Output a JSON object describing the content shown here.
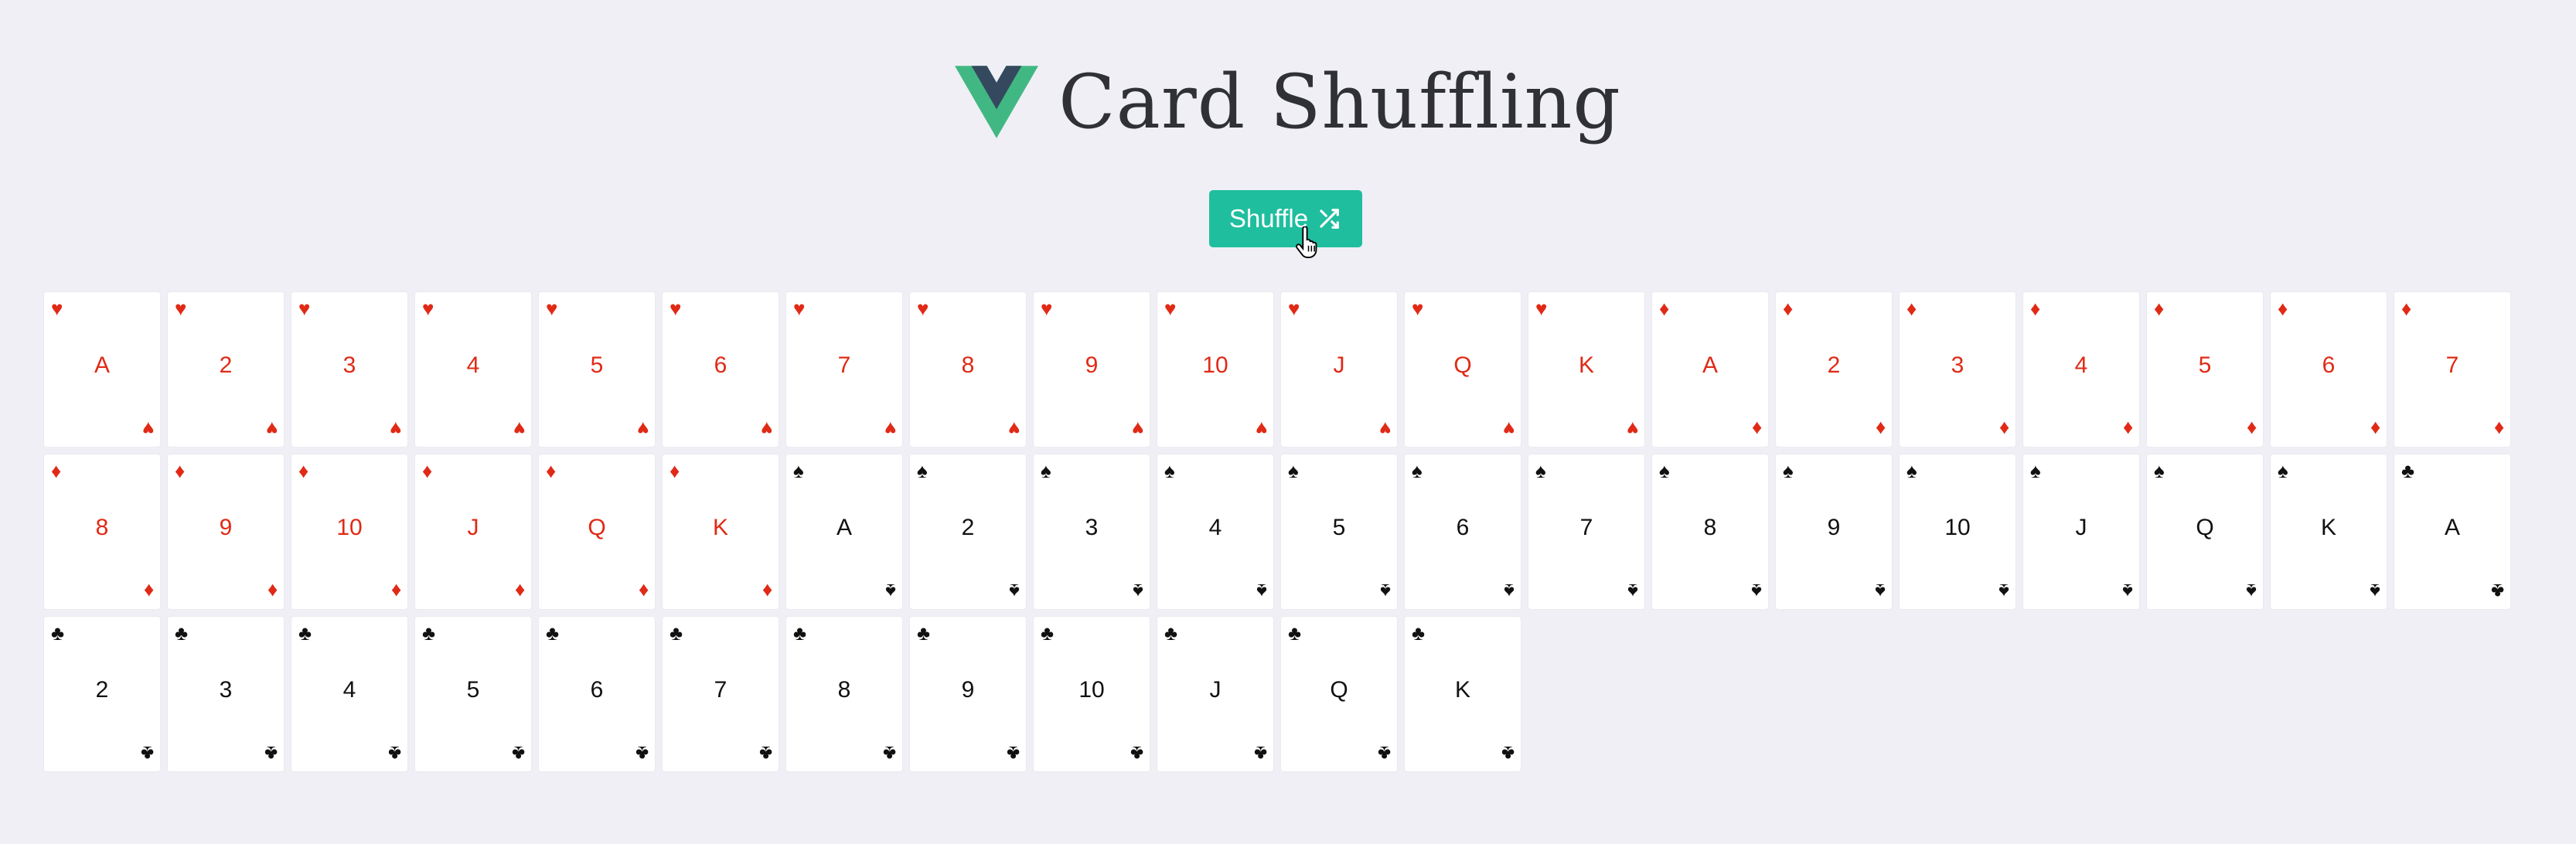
{
  "header": {
    "title": "Card Shuffling",
    "logo_icon": "vue-logo-icon",
    "logo_colors": {
      "outer": "#41b883",
      "inner": "#35495e"
    }
  },
  "toolbar": {
    "shuffle_label": "Shuffle",
    "shuffle_icon": "shuffle-icon",
    "button_color": "#1fbe9e"
  },
  "colors": {
    "background": "#efeff5",
    "red_suit": "#e02a16",
    "black_suit": "#111111"
  },
  "deck": [
    {
      "rank": "A",
      "suit": "♥",
      "suit_name": "hearts",
      "color": "red"
    },
    {
      "rank": "2",
      "suit": "♥",
      "suit_name": "hearts",
      "color": "red"
    },
    {
      "rank": "3",
      "suit": "♥",
      "suit_name": "hearts",
      "color": "red"
    },
    {
      "rank": "4",
      "suit": "♥",
      "suit_name": "hearts",
      "color": "red"
    },
    {
      "rank": "5",
      "suit": "♥",
      "suit_name": "hearts",
      "color": "red"
    },
    {
      "rank": "6",
      "suit": "♥",
      "suit_name": "hearts",
      "color": "red"
    },
    {
      "rank": "7",
      "suit": "♥",
      "suit_name": "hearts",
      "color": "red"
    },
    {
      "rank": "8",
      "suit": "♥",
      "suit_name": "hearts",
      "color": "red"
    },
    {
      "rank": "9",
      "suit": "♥",
      "suit_name": "hearts",
      "color": "red"
    },
    {
      "rank": "10",
      "suit": "♥",
      "suit_name": "hearts",
      "color": "red"
    },
    {
      "rank": "J",
      "suit": "♥",
      "suit_name": "hearts",
      "color": "red"
    },
    {
      "rank": "Q",
      "suit": "♥",
      "suit_name": "hearts",
      "color": "red"
    },
    {
      "rank": "K",
      "suit": "♥",
      "suit_name": "hearts",
      "color": "red"
    },
    {
      "rank": "A",
      "suit": "♦",
      "suit_name": "diamonds",
      "color": "red"
    },
    {
      "rank": "2",
      "suit": "♦",
      "suit_name": "diamonds",
      "color": "red"
    },
    {
      "rank": "3",
      "suit": "♦",
      "suit_name": "diamonds",
      "color": "red"
    },
    {
      "rank": "4",
      "suit": "♦",
      "suit_name": "diamonds",
      "color": "red"
    },
    {
      "rank": "5",
      "suit": "♦",
      "suit_name": "diamonds",
      "color": "red"
    },
    {
      "rank": "6",
      "suit": "♦",
      "suit_name": "diamonds",
      "color": "red"
    },
    {
      "rank": "7",
      "suit": "♦",
      "suit_name": "diamonds",
      "color": "red"
    },
    {
      "rank": "8",
      "suit": "♦",
      "suit_name": "diamonds",
      "color": "red"
    },
    {
      "rank": "9",
      "suit": "♦",
      "suit_name": "diamonds",
      "color": "red"
    },
    {
      "rank": "10",
      "suit": "♦",
      "suit_name": "diamonds",
      "color": "red"
    },
    {
      "rank": "J",
      "suit": "♦",
      "suit_name": "diamonds",
      "color": "red"
    },
    {
      "rank": "Q",
      "suit": "♦",
      "suit_name": "diamonds",
      "color": "red"
    },
    {
      "rank": "K",
      "suit": "♦",
      "suit_name": "diamonds",
      "color": "red"
    },
    {
      "rank": "A",
      "suit": "♠",
      "suit_name": "spades",
      "color": "black"
    },
    {
      "rank": "2",
      "suit": "♠",
      "suit_name": "spades",
      "color": "black"
    },
    {
      "rank": "3",
      "suit": "♠",
      "suit_name": "spades",
      "color": "black"
    },
    {
      "rank": "4",
      "suit": "♠",
      "suit_name": "spades",
      "color": "black"
    },
    {
      "rank": "5",
      "suit": "♠",
      "suit_name": "spades",
      "color": "black"
    },
    {
      "rank": "6",
      "suit": "♠",
      "suit_name": "spades",
      "color": "black"
    },
    {
      "rank": "7",
      "suit": "♠",
      "suit_name": "spades",
      "color": "black"
    },
    {
      "rank": "8",
      "suit": "♠",
      "suit_name": "spades",
      "color": "black"
    },
    {
      "rank": "9",
      "suit": "♠",
      "suit_name": "spades",
      "color": "black"
    },
    {
      "rank": "10",
      "suit": "♠",
      "suit_name": "spades",
      "color": "black"
    },
    {
      "rank": "J",
      "suit": "♠",
      "suit_name": "spades",
      "color": "black"
    },
    {
      "rank": "Q",
      "suit": "♠",
      "suit_name": "spades",
      "color": "black"
    },
    {
      "rank": "K",
      "suit": "♠",
      "suit_name": "spades",
      "color": "black"
    },
    {
      "rank": "A",
      "suit": "♣",
      "suit_name": "clubs",
      "color": "black"
    },
    {
      "rank": "2",
      "suit": "♣",
      "suit_name": "clubs",
      "color": "black"
    },
    {
      "rank": "3",
      "suit": "♣",
      "suit_name": "clubs",
      "color": "black"
    },
    {
      "rank": "4",
      "suit": "♣",
      "suit_name": "clubs",
      "color": "black"
    },
    {
      "rank": "5",
      "suit": "♣",
      "suit_name": "clubs",
      "color": "black"
    },
    {
      "rank": "6",
      "suit": "♣",
      "suit_name": "clubs",
      "color": "black"
    },
    {
      "rank": "7",
      "suit": "♣",
      "suit_name": "clubs",
      "color": "black"
    },
    {
      "rank": "8",
      "suit": "♣",
      "suit_name": "clubs",
      "color": "black"
    },
    {
      "rank": "9",
      "suit": "♣",
      "suit_name": "clubs",
      "color": "black"
    },
    {
      "rank": "10",
      "suit": "♣",
      "suit_name": "clubs",
      "color": "black"
    },
    {
      "rank": "J",
      "suit": "♣",
      "suit_name": "clubs",
      "color": "black"
    },
    {
      "rank": "Q",
      "suit": "♣",
      "suit_name": "clubs",
      "color": "black"
    },
    {
      "rank": "K",
      "suit": "♣",
      "suit_name": "clubs",
      "color": "black"
    }
  ]
}
